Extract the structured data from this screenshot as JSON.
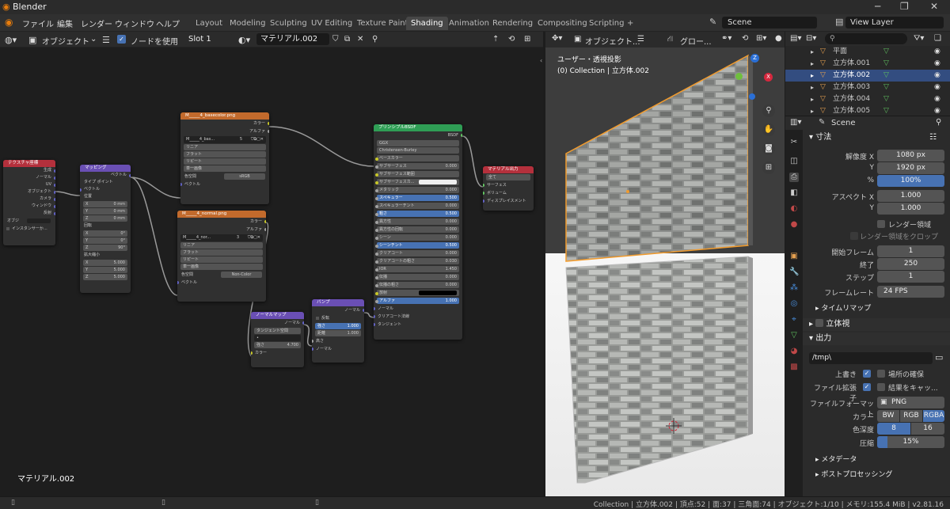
{
  "window": {
    "title": "Blender",
    "controls": [
      "─",
      "❐",
      "✕"
    ]
  },
  "menu": [
    "ファイル",
    "編集",
    "レンダー",
    "ウィンドウ",
    "ヘルプ"
  ],
  "workspace_tabs": [
    "Layout",
    "Modeling",
    "Sculpting",
    "UV Editing",
    "Texture Paint",
    "Shading",
    "Animation",
    "Rendering",
    "Compositing",
    "Scripting",
    "+"
  ],
  "active_tab": "Shading",
  "scene": {
    "name": "Scene",
    "view_layer": "View Layer"
  },
  "node_editor": {
    "object_mode": "オブジェクト",
    "use_nodes_label": "ノードを使用",
    "slot": "Slot 1",
    "material": "マテリアル.002",
    "footer_label": "マテリアル.002",
    "nodes": {
      "texcoord": {
        "title": "テクスチャ座標",
        "outputs": [
          "生成",
          "ノーマル",
          "UV",
          "オブジェクト",
          "カメラ",
          "ウィンドウ",
          "反射"
        ],
        "object_label": "オブジ",
        "instancer": "インスタンサーか..."
      },
      "mapping": {
        "title": "マッピング",
        "out": "ベクトル",
        "type_label": "タイプ",
        "type_value": "ポイント",
        "in": "ベクトル",
        "loc_label": "位置",
        "loc": [
          [
            "X",
            "0 mm"
          ],
          [
            "Y",
            "0 mm"
          ],
          [
            "Z",
            "0 mm"
          ]
        ],
        "rot_label": "回転",
        "rot": [
          [
            "X",
            "0°"
          ],
          [
            "Y",
            "0°"
          ],
          [
            "Z",
            "90°"
          ]
        ],
        "scale_label": "拡大縮小",
        "scale": [
          [
            "X",
            "5.000"
          ],
          [
            "Y",
            "5.000"
          ],
          [
            "Z",
            "5.000"
          ]
        ]
      },
      "tex1": {
        "title": "M_____4_basecolor.png",
        "outs": [
          "カラー",
          "アルファ"
        ],
        "image": "M_____4_bas...",
        "users": "5",
        "opts": [
          "リニア",
          "フラット",
          "リピート",
          "単一画像"
        ],
        "cs_label": "色空間",
        "cs": "sRGB",
        "in": "ベクトル"
      },
      "tex2": {
        "title": "M_____4_normal.png",
        "outs": [
          "カラー",
          "アルファ"
        ],
        "image": "M_____4_nor...",
        "users": "3",
        "opts": [
          "リニア",
          "フラット",
          "リピート",
          "単一画像"
        ],
        "cs_label": "色空間",
        "cs": "Non-Color",
        "in": "ベクトル"
      },
      "normalmap": {
        "title": "ノーマルマップ",
        "out": "ノーマル",
        "space": "タンジェント空間",
        "strength_label": "強さ",
        "strength": "4.700",
        "in": "カラー"
      },
      "bump": {
        "title": "バンプ",
        "out": "ノーマル",
        "invert": "反転",
        "strength_label": "強さ",
        "strength": "1.000",
        "dist_label": "距離",
        "dist": "1.000",
        "height": "高さ",
        "in": "ノーマル"
      },
      "bsdf": {
        "title": "プリンシプルBSDF",
        "out": "BSDF",
        "dist": "GGX",
        "sss": "Christensen-Burley",
        "rows": [
          [
            "ベースカラー",
            ""
          ],
          [
            "サブサーフェス",
            "0.000"
          ],
          [
            "サブサーフェス範囲",
            ""
          ],
          [
            "サブサーフェスカ...",
            ""
          ],
          [
            "メタリック",
            "0.000"
          ],
          [
            "スペキュラー",
            "0.500"
          ],
          [
            "スペキュラーチント",
            "0.000"
          ],
          [
            "粗さ",
            "0.500"
          ],
          [
            "異方性",
            "0.000"
          ],
          [
            "異方性の回転",
            "0.000"
          ],
          [
            "シーン",
            "0.000"
          ],
          [
            "シーンチント",
            "0.500"
          ],
          [
            "クリアコート",
            "0.000"
          ],
          [
            "クリアコートの粗さ",
            "0.030"
          ],
          [
            "IOR",
            "1.450"
          ],
          [
            "伝播",
            "0.000"
          ],
          [
            "伝播の粗さ",
            "0.000"
          ],
          [
            "放射",
            ""
          ],
          [
            "アルファ",
            "1.000"
          ],
          [
            "ノーマル",
            ""
          ],
          [
            "クリアコート法線",
            ""
          ],
          [
            "タンジェント",
            ""
          ]
        ]
      },
      "output": {
        "title": "マテリアル出力",
        "target": "全て",
        "ins": [
          "サーフェス",
          "ボリューム",
          "ディスプレイスメント"
        ]
      }
    }
  },
  "viewport": {
    "mode": "オブジェクト...",
    "orientation": "グロー...",
    "view_name": "ユーザー・透視投影",
    "collection": "(0) Collection | 立方体.002"
  },
  "outliner": {
    "search_placeholder": "",
    "rows": [
      {
        "name": "平面",
        "selected": false
      },
      {
        "name": "立方体.001",
        "selected": false
      },
      {
        "name": "立方体.002",
        "selected": true
      },
      {
        "name": "立方体.003",
        "selected": false
      },
      {
        "name": "立方体.004",
        "selected": false
      },
      {
        "name": "立方体.005",
        "selected": false
      }
    ]
  },
  "properties": {
    "scene_name": "Scene",
    "dimensions": {
      "title": "寸法",
      "res_x_label": "解像度 X",
      "res_x": "1080 px",
      "res_y_label": "Y",
      "res_y": "1920 px",
      "pct_label": "%",
      "pct": "100%",
      "aspect_x_label": "アスペクト X",
      "aspect_x": "1.000",
      "aspect_y_label": "Y",
      "aspect_y": "1.000",
      "border": "レンダー領域",
      "crop": "レンダー領域をクロップ",
      "frame_start_label": "開始フレーム",
      "frame_start": "1",
      "frame_end_label": "終了",
      "frame_end": "250",
      "frame_step_label": "ステップ",
      "frame_step": "1",
      "fps_label": "フレームレート",
      "fps": "24 FPS",
      "time_remap": "タイムリマップ"
    },
    "stereo": "立体視",
    "output": {
      "title": "出力",
      "path": "/tmp\\",
      "overwrite": "上書き",
      "placeholders": "場所の確保",
      "ext": "ファイル拡張子",
      "cache": "結果をキャッ...",
      "format_label": "ファイルフォーマット",
      "format": "PNG",
      "color_label": "カラー",
      "color_opts": [
        "BW",
        "RGB",
        "RGBA"
      ],
      "depth_label": "色深度",
      "depth_opts": [
        "8",
        "16"
      ],
      "compress_label": "圧縮",
      "compress": "15%"
    },
    "metadata": "メタデータ",
    "postproc": "ポストプロセッシング"
  },
  "status": "Collection | 立方体.002 | 頂点:52 | 面:37 | 三角面:74 | オブジェクト:1/10 | メモリ:155.4 MiB | v2.81.16"
}
